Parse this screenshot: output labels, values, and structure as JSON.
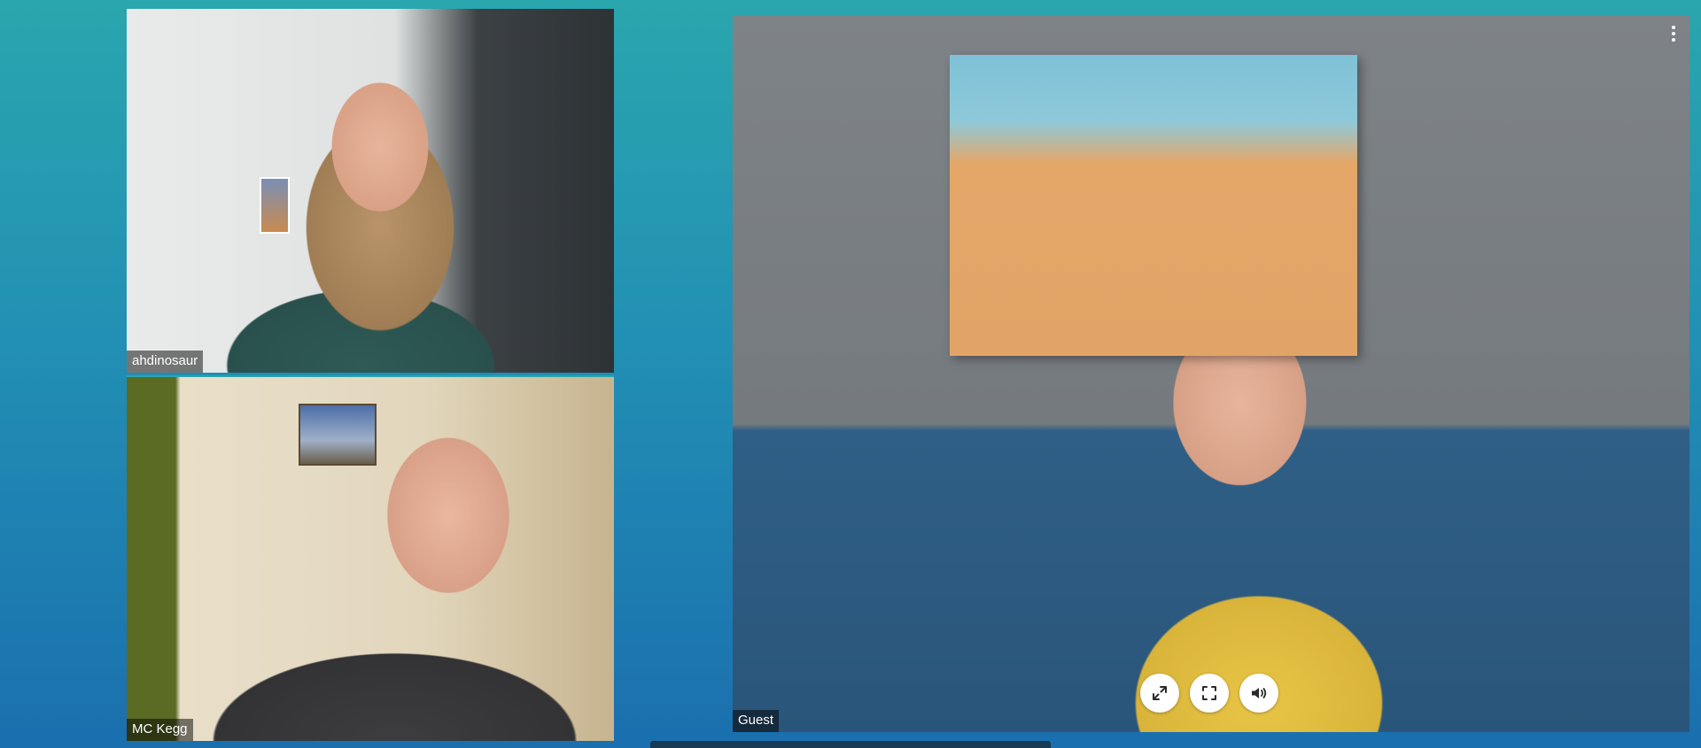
{
  "participants": [
    {
      "id": "a",
      "name": "ahdinosaur"
    },
    {
      "id": "b",
      "name": "MC Kegg"
    },
    {
      "id": "c",
      "name": "Guest"
    }
  ],
  "main_tile": {
    "menu_icon": "more-vertical-icon",
    "controls": [
      {
        "id": "expand",
        "icon": "expand-diagonal-icon"
      },
      {
        "id": "fullscreen",
        "icon": "fullscreen-icon"
      },
      {
        "id": "volume",
        "icon": "volume-icon"
      }
    ]
  },
  "colors": {
    "background_top": "#2aa6ae",
    "background_bottom": "#1a6fae",
    "name_tag_bg": "rgba(0,0,0,0.5)",
    "button_bg": "#ffffff",
    "icon": "#2b2b2b"
  }
}
